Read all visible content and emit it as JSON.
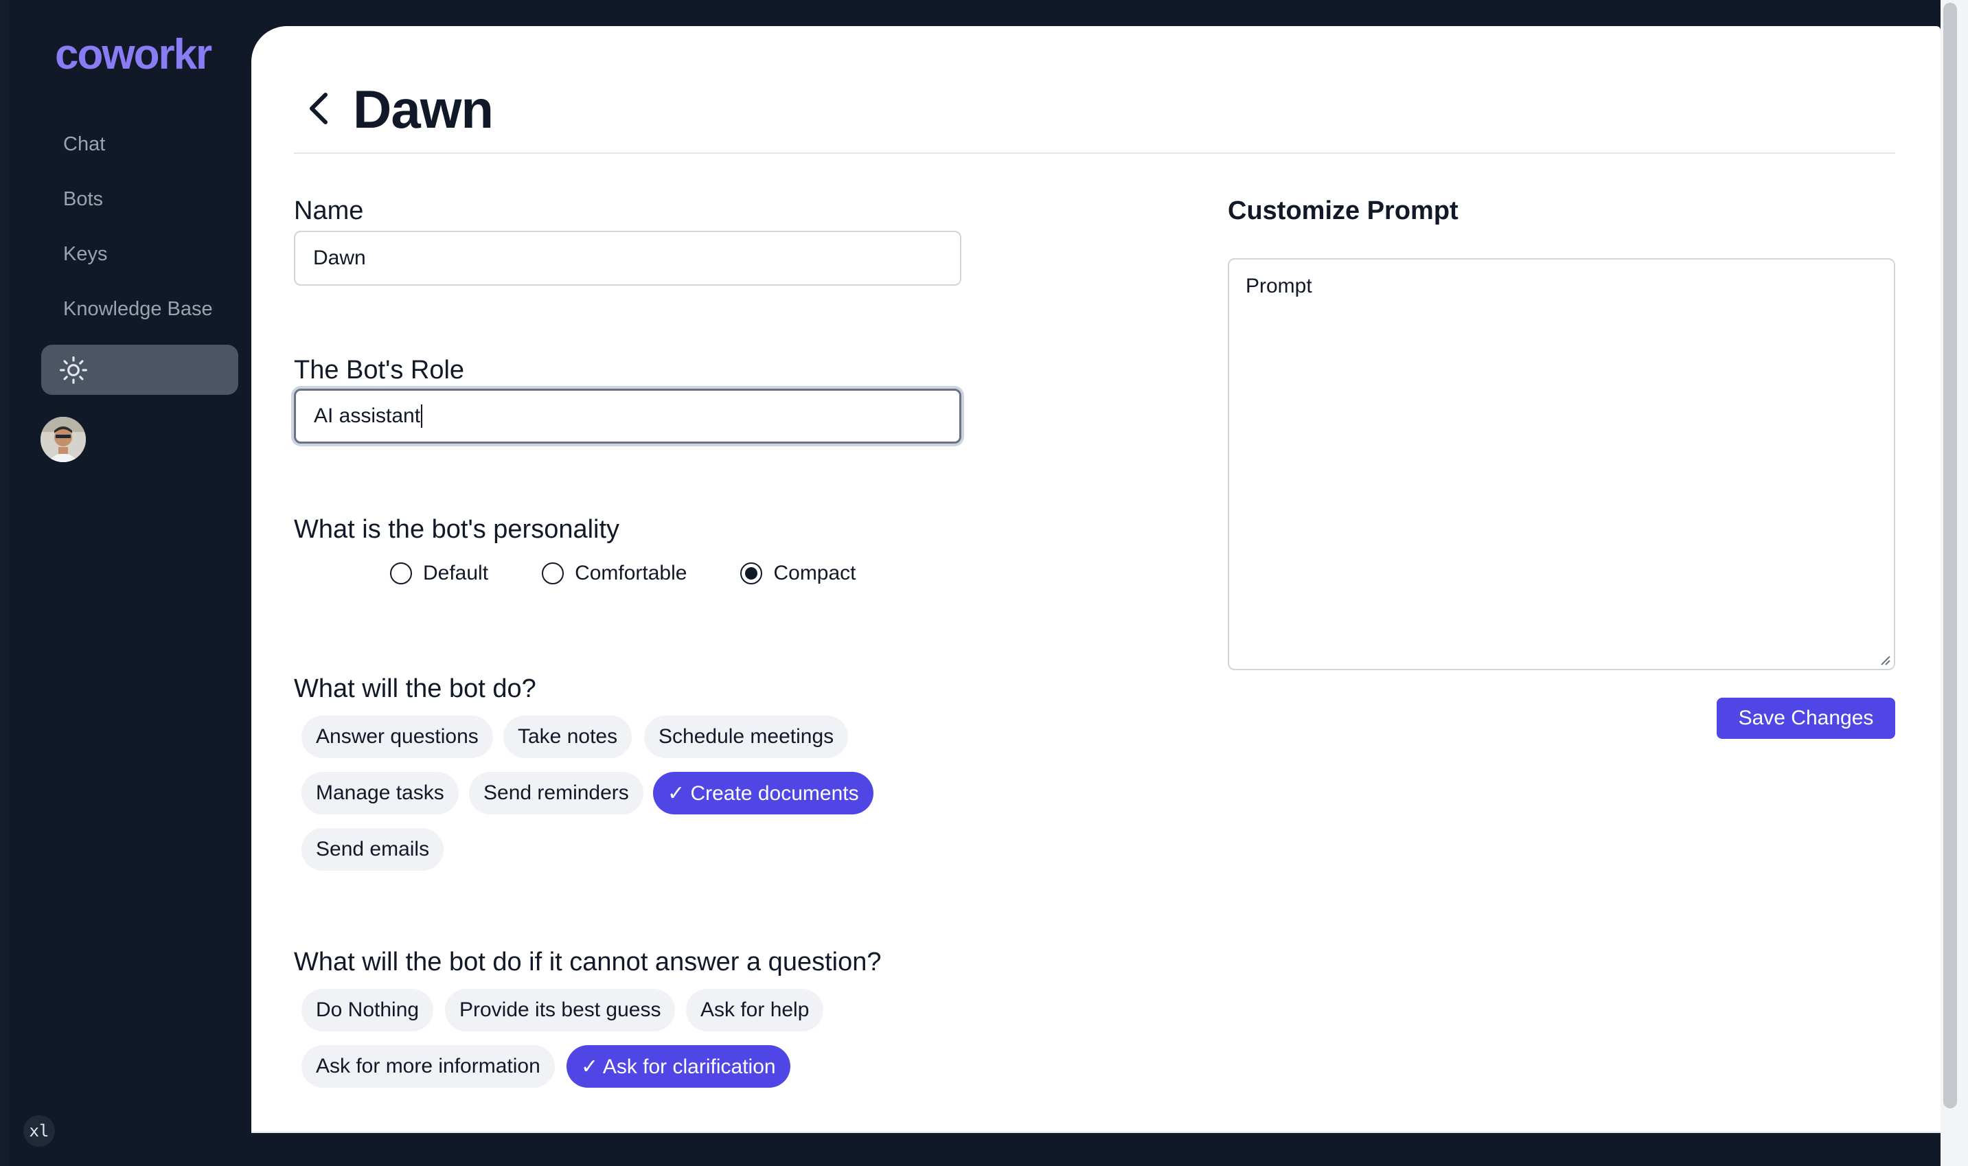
{
  "app": {
    "logo": "coworkr"
  },
  "sidebar": {
    "items": [
      {
        "label": "Chat"
      },
      {
        "label": "Bots"
      },
      {
        "label": "Keys"
      },
      {
        "label": "Knowledge Base"
      }
    ],
    "theme_icon": "sun-icon",
    "avatar_icon": "user-avatar"
  },
  "breakpoint_badge": "xl",
  "header": {
    "title": "Dawn",
    "back_icon": "chevron-left-icon"
  },
  "form": {
    "name": {
      "label": "Name",
      "value": "Dawn"
    },
    "role": {
      "label": "The Bot's Role",
      "value": "AI assistant"
    },
    "personality": {
      "label": "What is the bot's personality",
      "options": [
        "Default",
        "Comfortable",
        "Compact"
      ],
      "selected": "Compact"
    },
    "tasks": {
      "label": "What will the bot do?",
      "options": [
        {
          "label": "Answer questions",
          "selected": false
        },
        {
          "label": "Take notes",
          "selected": false
        },
        {
          "label": "Schedule meetings",
          "selected": false
        },
        {
          "label": "Manage tasks",
          "selected": false
        },
        {
          "label": "Send reminders",
          "selected": false
        },
        {
          "label": "✓ Create documents",
          "selected": true
        },
        {
          "label": "Send emails",
          "selected": false
        }
      ]
    },
    "fallback": {
      "label": "What will the bot do if it cannot answer a question?",
      "options": [
        {
          "label": "Do Nothing",
          "selected": false
        },
        {
          "label": "Provide its best guess",
          "selected": false
        },
        {
          "label": "Ask for help",
          "selected": false
        },
        {
          "label": "Ask for more information",
          "selected": false
        },
        {
          "label": "✓ Ask for clarification",
          "selected": true
        }
      ]
    }
  },
  "prompt": {
    "label": "Customize Prompt",
    "placeholder": "Prompt"
  },
  "actions": {
    "save_label": "Save Changes"
  },
  "colors": {
    "accent": "#4f46e5",
    "sidebar_bg": "#111827",
    "logo": "#8b7cf6"
  }
}
